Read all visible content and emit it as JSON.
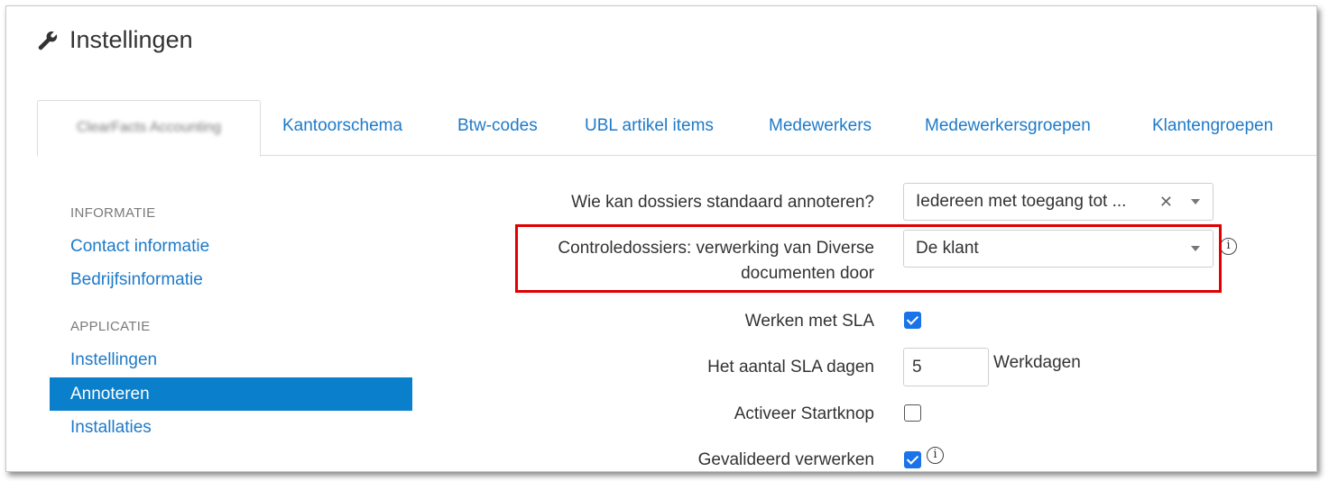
{
  "page": {
    "title": "Instellingen",
    "title_icon": "wrench-icon"
  },
  "tabs": [
    {
      "label": "ClearFacts Accounting",
      "active": true,
      "blurred": true
    },
    {
      "label": "Kantoorschema"
    },
    {
      "label": "Btw-codes"
    },
    {
      "label": "UBL artikel items"
    },
    {
      "label": "Medewerkers"
    },
    {
      "label": "Medewerkersgroepen"
    },
    {
      "label": "Klantengroepen"
    }
  ],
  "sidebar": {
    "sections": [
      {
        "heading": "INFORMATIE",
        "items": [
          "Contact informatie",
          "Bedrijfsinformatie"
        ]
      },
      {
        "heading": "APPLICATIE",
        "items": [
          "Instellingen",
          "Annoteren",
          "Installaties"
        ]
      }
    ],
    "active_item": "Annoteren"
  },
  "form": {
    "annotate_default": {
      "label": "Wie kan dossiers standaard annoteren?",
      "value": "Iedereen met toegang tot ...",
      "clear_glyph": "✕"
    },
    "control_files": {
      "label_line1": "Controledossiers: verwerking van Diverse",
      "label_line2": "documenten door",
      "value": "De klant"
    },
    "sla": {
      "label": "Werken met SLA",
      "checked": true
    },
    "sla_days": {
      "label": "Het aantal SLA dagen",
      "value": "5",
      "unit": "Werkdagen"
    },
    "start_button": {
      "label": "Activeer Startknop",
      "checked": false
    },
    "validated": {
      "label": "Gevalideerd verwerken",
      "checked": true
    }
  },
  "colors": {
    "link": "#1e7ac8",
    "active_bg": "#0a7fcc",
    "highlight": "#e00000",
    "checkbox": "#1a73e8"
  }
}
